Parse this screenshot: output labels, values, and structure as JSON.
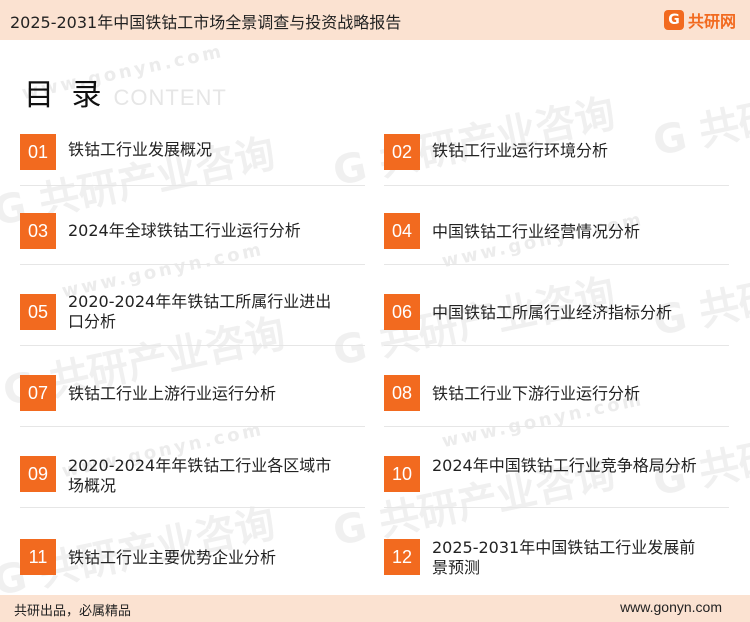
{
  "header": {
    "title": "2025-2031年中国铁钴工市场全景调查与投资战略报告",
    "brand_icon": "G",
    "brand_name": "共研网"
  },
  "heading": {
    "title": "目 录",
    "subtitle": "CONTENT"
  },
  "watermark": {
    "text": "G 共研产业咨询",
    "url": "www.gonyn.com"
  },
  "toc": [
    {
      "num": "01",
      "label": "铁钴工行业发展概况"
    },
    {
      "num": "02",
      "label": "铁钴工行业运行环境分析"
    },
    {
      "num": "03",
      "label": "2024年全球铁钴工行业运行分析"
    },
    {
      "num": "04",
      "label": "中国铁钴工行业经营情况分析"
    },
    {
      "num": "05",
      "label": "2020-2024年年铁钴工所属行业进出口分析"
    },
    {
      "num": "06",
      "label": "中国铁钴工所属行业经济指标分析"
    },
    {
      "num": "07",
      "label": "铁钴工行业上游行业运行分析"
    },
    {
      "num": "08",
      "label": "铁钴工行业下游行业运行分析"
    },
    {
      "num": "09",
      "label": "2020-2024年年铁钴工行业各区域市场概况"
    },
    {
      "num": "10",
      "label": "2024年中国铁钴工行业竞争格局分析"
    },
    {
      "num": "11",
      "label": "铁钴工行业主要优势企业分析"
    },
    {
      "num": "12",
      "label": "2025-2031年中国铁钴工行业发展前景预测"
    }
  ],
  "footer": {
    "slogan": "共研出品，必属精品",
    "site": "www.gonyn.com"
  },
  "colors": {
    "accent": "#f26a1f",
    "band": "#fbe2d1"
  }
}
